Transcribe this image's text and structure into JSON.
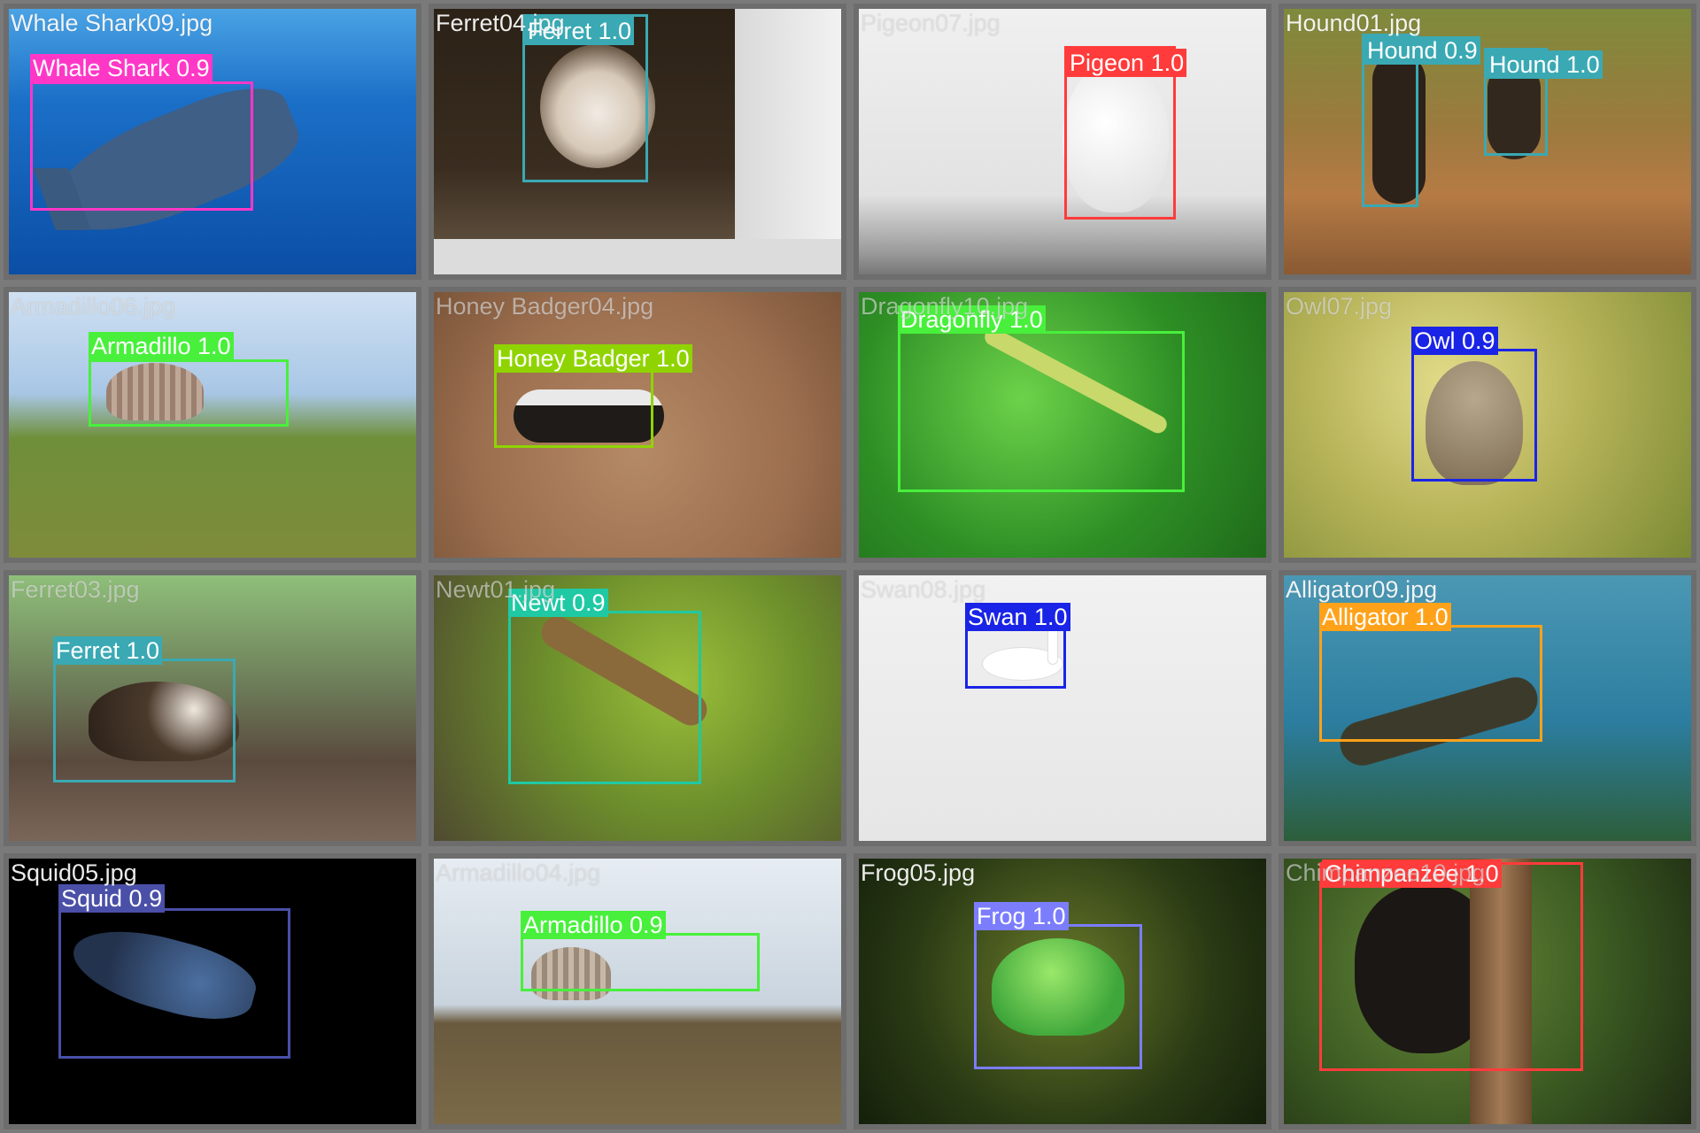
{
  "tiles": [
    {
      "filename": "Whale Shark09.jpg",
      "detections": [
        {
          "label": "Whale Shark 0.9",
          "color": "#ff37c7"
        }
      ]
    },
    {
      "filename": "Ferret04.jpg",
      "detections": [
        {
          "label": "Ferret 1.0",
          "color": "#3aa9b3"
        }
      ]
    },
    {
      "filename": "Pigeon07.jpg",
      "detections": [
        {
          "label": "Pigeon 1.0",
          "color": "#ff3b3b"
        }
      ]
    },
    {
      "filename": "Hound01.jpg",
      "detections": [
        {
          "label": "Hound 0.9",
          "color": "#3aa9b3"
        },
        {
          "label": "Hound 1.0",
          "color": "#3aa9b3"
        }
      ]
    },
    {
      "filename": "Armadillo06.jpg",
      "detections": [
        {
          "label": "Armadillo 1.0",
          "color": "#48f03c"
        }
      ]
    },
    {
      "filename": "Honey Badger04.jpg",
      "detections": [
        {
          "label": "Honey Badger 1.0",
          "color": "#8fd400"
        }
      ]
    },
    {
      "filename": "Dragonfly10.jpg",
      "detections": [
        {
          "label": "Dragonfly 1.0",
          "color": "#48f03c"
        }
      ]
    },
    {
      "filename": "Owl07.jpg",
      "detections": [
        {
          "label": "Owl 0.9",
          "color": "#1a24e6"
        }
      ]
    },
    {
      "filename": "Ferret03.jpg",
      "detections": [
        {
          "label": "Ferret 1.0",
          "color": "#3aa9b3"
        }
      ]
    },
    {
      "filename": "Newt01.jpg",
      "detections": [
        {
          "label": "Newt 0.9",
          "color": "#1fc9a4"
        }
      ]
    },
    {
      "filename": "Swan08.jpg",
      "detections": [
        {
          "label": "Swan 1.0",
          "color": "#1a24e6"
        }
      ]
    },
    {
      "filename": "Alligator09.jpg",
      "detections": [
        {
          "label": "Alligator 1.0",
          "color": "#ffa21a"
        }
      ]
    },
    {
      "filename": "Squid05.jpg",
      "detections": [
        {
          "label": "Squid 0.9",
          "color": "#4a4fa8"
        }
      ]
    },
    {
      "filename": "Armadillo04.jpg",
      "detections": [
        {
          "label": "Armadillo 0.9",
          "color": "#48f03c"
        }
      ]
    },
    {
      "filename": "Frog05.jpg",
      "detections": [
        {
          "label": "Frog 1.0",
          "color": "#7b7dfd"
        }
      ]
    },
    {
      "filename": "Chimpanzee10.jpg",
      "detections": [
        {
          "label": "Chimpanzee 1.0",
          "color": "#ff3b3b"
        }
      ]
    }
  ]
}
